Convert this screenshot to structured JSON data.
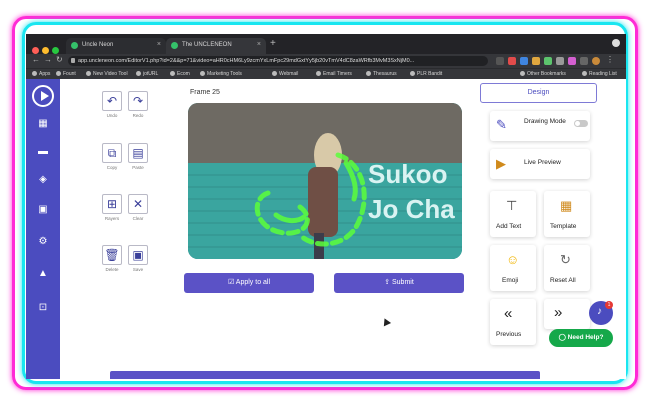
{
  "browser": {
    "tabs": [
      {
        "title": "Uncle Neon"
      },
      {
        "title": "The UNCLENEON"
      }
    ],
    "url": "app.uncleneon.com/EditorV1.php?id=2&&p=71&video=aHR0cHM6Ly9zcmYxLmFpc29mdGxtYy5jb20vTmV4dC8zaWRfb3MvM3SxNjM0...",
    "bookmarks": [
      "Apps",
      "Fount",
      "New Video Tool",
      "jotURL",
      "Ecom",
      "Marketing Tools",
      "Webmail",
      "Email Timers",
      "Thesaurus",
      "PLR Bandit",
      "Other Bookmarks",
      "Reading List"
    ]
  },
  "tools": [
    {
      "label": "Undo"
    },
    {
      "label": "Redo"
    },
    {
      "label": "Copy"
    },
    {
      "label": "Paste"
    },
    {
      "label": "Rayers"
    },
    {
      "label": "Clear"
    },
    {
      "label": "Delete"
    },
    {
      "label": "Save"
    }
  ],
  "editor": {
    "frame_label": "Frame 25",
    "video_text_line1": "Sukoo",
    "video_text_line2": "Jo Cha",
    "apply_label": "Apply to all",
    "submit_label": "Submit"
  },
  "panel": {
    "design_tab": "Design",
    "drawing_mode": "Drawing Mode",
    "live_preview": "Live Preview",
    "add_text": "Add Text",
    "template": "Template",
    "emoji": "Emoji",
    "reset_all": "Reset All",
    "previous": "Previous",
    "help": "Need Help?",
    "bell_badge": "1"
  },
  "colors": {
    "brand": "#4b4cbf",
    "button": "#5b52c6",
    "help": "#15a84a",
    "neon_pink": "#ff2bd6",
    "neon_cyan": "#19e6f0",
    "neon_green": "#5cff3b"
  }
}
